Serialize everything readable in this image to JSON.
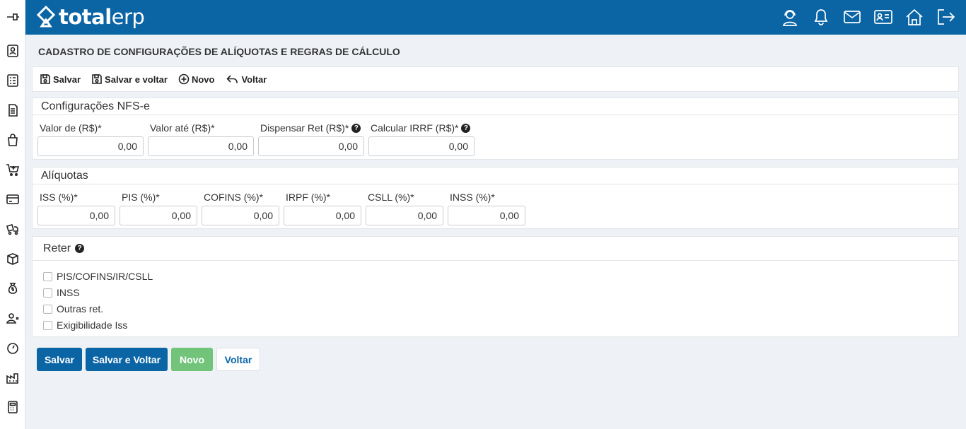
{
  "brand": {
    "bold": "total",
    "light": "erp"
  },
  "sidebar": {
    "icons": [
      "pin-icon",
      "user-card-icon",
      "list-icon",
      "document-icon",
      "bag-icon",
      "cart-icon",
      "credit-card-icon",
      "truck-icon",
      "box-icon",
      "money-bag-icon",
      "user-remove-icon",
      "gauge-icon",
      "factory-icon",
      "calculator-icon"
    ]
  },
  "header": {
    "icons": [
      "support-icon",
      "bell-icon",
      "mail-icon",
      "id-card-icon",
      "home-icon",
      "logout-icon"
    ]
  },
  "page": {
    "title": "CADASTRO DE CONFIGURAÇÕES DE ALÍQUOTAS E REGRAS DE CÁLCULO"
  },
  "toolbar": {
    "save": "Salvar",
    "save_back": "Salvar e voltar",
    "new": "Novo",
    "back": "Voltar"
  },
  "nfse": {
    "title": "Configurações NFS-e",
    "fields": [
      {
        "label": "Valor de (R$)*",
        "value": "0,00",
        "help": false
      },
      {
        "label": "Valor até (R$)*",
        "value": "0,00",
        "help": false
      },
      {
        "label": "Dispensar Ret (R$)*",
        "value": "0,00",
        "help": true
      },
      {
        "label": "Calcular IRRF (R$)*",
        "value": "0,00",
        "help": true
      }
    ]
  },
  "aliquotas": {
    "title": "Alíquotas",
    "fields": [
      {
        "label": "ISS (%)*",
        "value": "0,00"
      },
      {
        "label": "PIS (%)*",
        "value": "0,00"
      },
      {
        "label": "COFINS (%)*",
        "value": "0,00"
      },
      {
        "label": "IRPF (%)*",
        "value": "0,00"
      },
      {
        "label": "CSLL (%)*",
        "value": "0,00"
      },
      {
        "label": "INSS (%)*",
        "value": "0,00"
      }
    ]
  },
  "reter": {
    "title": "Reter",
    "options": [
      {
        "label": "PIS/COFINS/IR/CSLL",
        "checked": false
      },
      {
        "label": "INSS",
        "checked": false
      },
      {
        "label": "Outras ret.",
        "checked": false
      },
      {
        "label": "Exigibilidade Iss",
        "checked": false
      }
    ]
  },
  "buttons": {
    "save": "Salvar",
    "save_back": "Salvar e Voltar",
    "new": "Novo",
    "back": "Voltar"
  },
  "colors": {
    "brand": "#0b65a5",
    "success": "#72c47a",
    "background": "#eef1f5"
  }
}
